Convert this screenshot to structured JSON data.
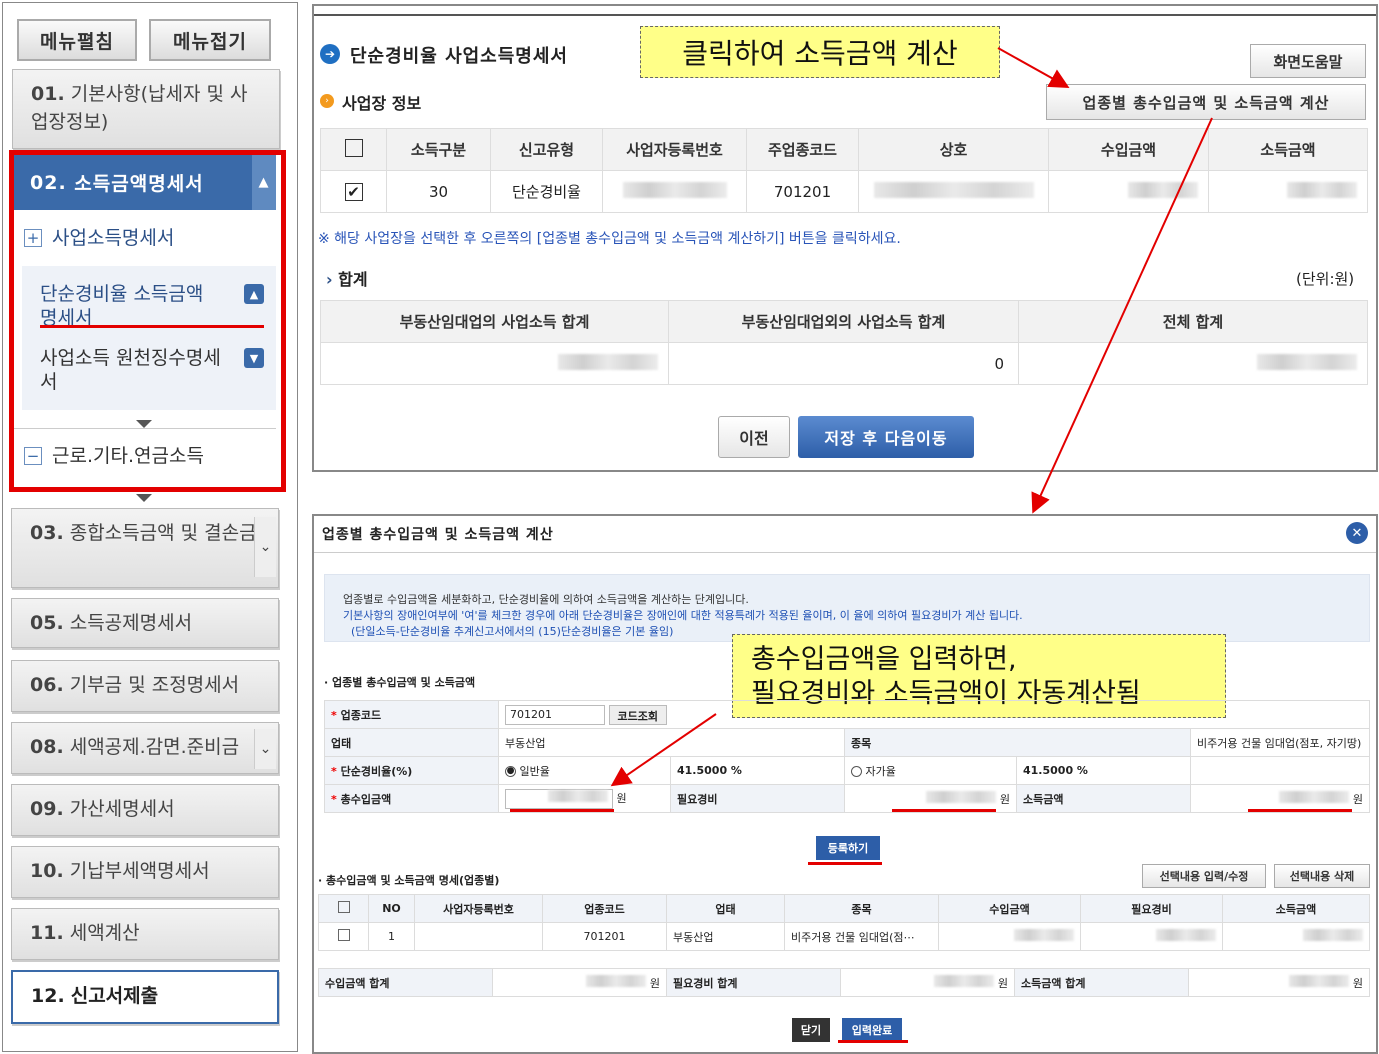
{
  "sidebar": {
    "menu_expand": "메뉴펼침",
    "menu_collapse": "메뉴접기",
    "item01": {
      "num": "01.",
      "label": "기본사항(납세자 및 사업장정보)"
    },
    "item02": {
      "num": "02.",
      "label": "소득금액명세서"
    },
    "sub_business": "사업소득명세서",
    "sub_simple_rate": "단순경비율 소득금액명세서",
    "sub_withholding": "사업소득 원천징수명세서",
    "sub_labor": "근로.기타.연금소득",
    "item03": {
      "num": "03.",
      "label": "종합소득금액 및 결손금"
    },
    "item05": {
      "num": "05.",
      "label": "소득공제명세서"
    },
    "item06": {
      "num": "06.",
      "label": "기부금 및 조정명세서"
    },
    "item08": {
      "num": "08.",
      "label": "세액공제.감면.준비금"
    },
    "item09": {
      "num": "09.",
      "label": "가산세명세서"
    },
    "item10": {
      "num": "10.",
      "label": "기납부세액명세서"
    },
    "item11": {
      "num": "11.",
      "label": "세액계산"
    },
    "item12": {
      "num": "12.",
      "label": "신고서제출"
    }
  },
  "top": {
    "title": "단순경비율 사업소득명세서",
    "help_button": "화면도움말",
    "section_business": "사업장 정보",
    "calc_button": "업종별 총수입금액 및 소득금액 계산",
    "callout": "클릭하여 소득금액 계산",
    "table_headers": [
      "소득구분",
      "신고유형",
      "사업자등록번호",
      "주업종코드",
      "상호",
      "수입금액",
      "소득금액"
    ],
    "row": {
      "income_type": "30",
      "report_type": "단순경비율",
      "industry_code": "701201"
    },
    "notice": "※ 해당 사업장을 선택한 후 오른쪽의 [업종별 총수입금액 및 소득금액 계산하기] 버튼을 클릭하세요.",
    "total_title": "합계",
    "unit": "(단위:원)",
    "total_headers": [
      "부동산임대업의 사업소득 합계",
      "부동산임대업외의 사업소득 합계",
      "전체 합계"
    ],
    "total_non_rental": "0",
    "prev_button": "이전",
    "save_next_button": "저장 후 다음이동"
  },
  "popup": {
    "title": "업종별 총수입금액 및 소득금액 계산",
    "info1": "업종별로 수입금액을 세분화하고, 단순경비율에 의하여 소득금액을 계산하는 단계입니다.",
    "info2": "기본사항의 장애인여부에 '여'를 체크한 경우에 아래 단순경비율은 장애인에 대한 적용특례가 적용된 율이며, 이 율에 의하여 필요경비가 계산 됩니다.",
    "info3": "(단일소득-단순경비율 추계신고서에서의 (15)단순경비율은 기본 율임)",
    "callout_line1": "총수입금액을 입력하면,",
    "callout_line2": "필요경비와 소득금액이 자동계산됨",
    "section_form": "업종별 총수입금액 및 소득금액",
    "lbl_code": "업종코드",
    "code_value": "701201",
    "code_lookup": "코드조회",
    "lbl_business": "업태",
    "business_value": "부동산업",
    "lbl_item": "종목",
    "item_value": "비주거용 건물 임대업(점포, 자기땅)",
    "lbl_rate": "단순경비율(%)",
    "radio_general": "일반율",
    "rate_general": "41.5000 %",
    "radio_own": "자가율",
    "rate_own": "41.5000 %",
    "lbl_revenue": "총수입금액",
    "won": "원",
    "lbl_expense": "필요경비",
    "lbl_income": "소득금액",
    "register_button": "등록하기",
    "section_detail": "총수입금액 및 소득금액 명세(업종별)",
    "btn_edit": "선택내용 입력/수정",
    "btn_delete": "선택내용 삭제",
    "detail_headers": [
      "NO",
      "사업자등록번호",
      "업종코드",
      "업태",
      "종목",
      "수입금액",
      "필요경비",
      "소득금액"
    ],
    "detail_row": {
      "no": "1",
      "code": "701201",
      "business": "부동산업",
      "item": "비주거용 건물 임대업(점⋯"
    },
    "sum_revenue": "수입금액 합계",
    "sum_expense": "필요경비 합계",
    "sum_income": "소득금액 합계",
    "close_button": "닫기",
    "complete_button": "입력완료"
  },
  "colors": {
    "accent": "#3a6aa9",
    "highlight_red": "#e30000",
    "callout_yellow": "#ffff88"
  }
}
